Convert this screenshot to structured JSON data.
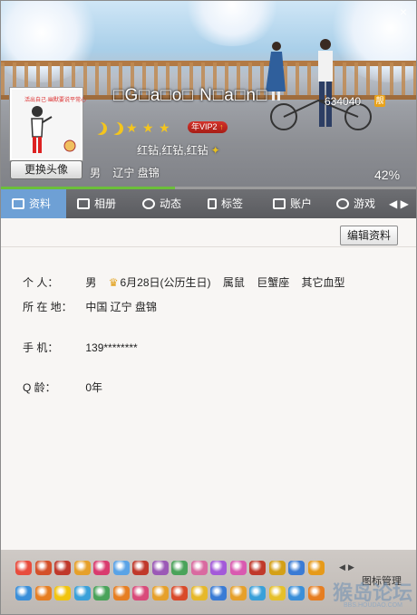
{
  "window": {
    "close_glyph": "×"
  },
  "profile": {
    "nickname": "□G□a□o□ N□a□n□",
    "qq_number": "634040",
    "qq_badge": "靓",
    "avatar_caption": "活出自己·幽默要说平常心",
    "change_avatar_label": "更换头像",
    "vip_label": "年VIP2",
    "vip_up": "↑",
    "diamonds": "红钻,红钻,红钻",
    "gender": "男",
    "location": "辽宁 盘锦",
    "progress_percent": 42,
    "progress_label": "42%"
  },
  "tabs": [
    {
      "label": "资料",
      "icon": "profile-card-icon",
      "active": true
    },
    {
      "label": "相册",
      "icon": "photo-album-icon",
      "active": false
    },
    {
      "label": "动态",
      "icon": "feed-icon",
      "active": false
    },
    {
      "label": "标签",
      "icon": "bookmark-icon",
      "active": false
    },
    {
      "label": "账户",
      "icon": "wallet-icon",
      "active": false
    },
    {
      "label": "游戏",
      "icon": "game-icon",
      "active": false
    }
  ],
  "tab_more_glyph": "◀ ▶",
  "content": {
    "edit_button": "编辑资料",
    "personal_label": "个    人：",
    "personal": {
      "gender": "男",
      "birthday": "6月28日(公历生日)",
      "zodiac": "属鼠",
      "constellation": "巨蟹座",
      "blood": "其它血型"
    },
    "location_label": "所 在 地：",
    "location_value": "中国 辽宁 盘锦",
    "phone_label": "手    机：",
    "phone_value": "139********",
    "qage_label": "Q      龄：",
    "qage_value": "0年"
  },
  "footer": {
    "manage_label": "图标管理",
    "arrow_left": "◀",
    "arrow_right": "▶",
    "watermark": "猴岛论坛",
    "watermark_url": "BBS.HOUDAO.COM"
  },
  "colors": {
    "accent_tab": "#6ea0d5",
    "progress": "#6bbf3a",
    "star": "#f4c51d"
  }
}
